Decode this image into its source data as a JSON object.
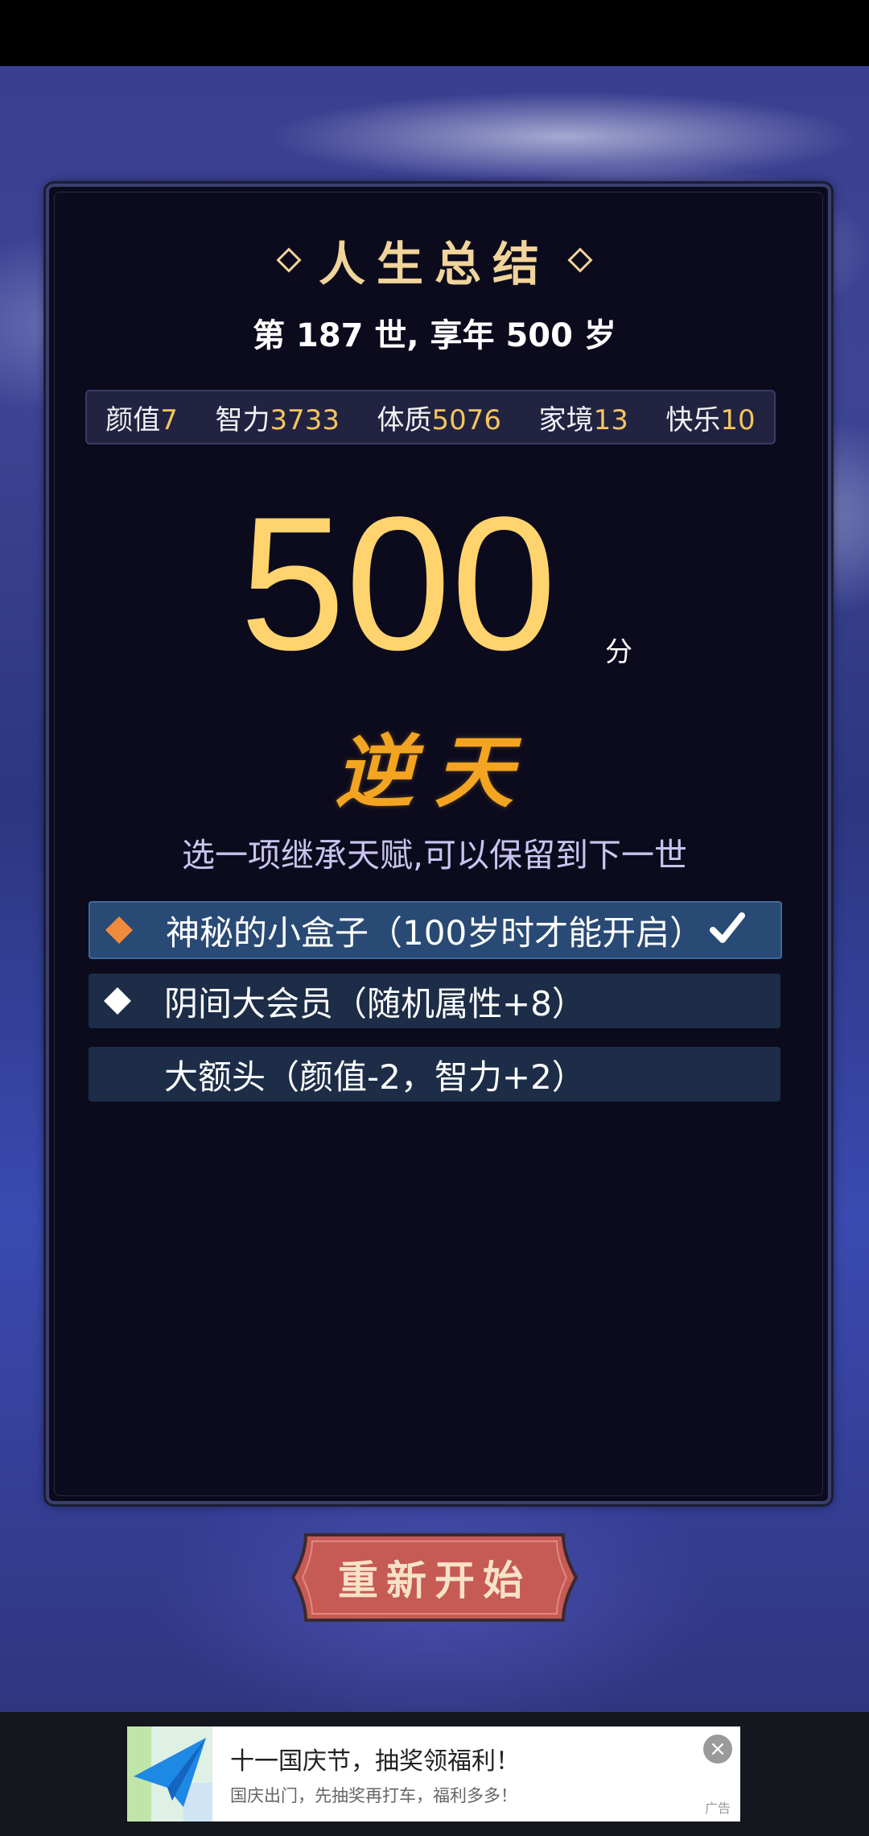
{
  "summary": {
    "title": "人生总结",
    "subtitle": "第 187 世, 享年 500 岁",
    "stats": [
      {
        "label": "颜值",
        "value": "7"
      },
      {
        "label": "智力",
        "value": "3733"
      },
      {
        "label": "体质",
        "value": "5076"
      },
      {
        "label": "家境",
        "value": "13"
      },
      {
        "label": "快乐",
        "value": "10"
      }
    ],
    "score": "500",
    "score_unit": "分",
    "rank": "逆天",
    "hint": "选一项继承天赋,可以保留到下一世"
  },
  "options": [
    {
      "label": "神秘的小盒子（100岁时才能开启）",
      "diamond_color": "#f08a3c",
      "selected": true
    },
    {
      "label": "阴间大会员（随机属性+8）",
      "diamond_color": "#f08a3c",
      "selected": false
    },
    {
      "label": "大额头（颜值-2，智力+2）",
      "diamond_color": "#ffffff",
      "selected": false
    }
  ],
  "restart_label": "重新开始",
  "ad": {
    "title": "十一国庆节，抽奖领福利！",
    "description": "国庆出门，先抽奖再打车，福利多多！",
    "tag": "广告",
    "close_icon": "close-icon"
  },
  "colors": {
    "accent_gold": "#ffd46e",
    "stat_value": "#f4c460",
    "rank": "#f3a522",
    "panel": "#0c0b1d"
  }
}
